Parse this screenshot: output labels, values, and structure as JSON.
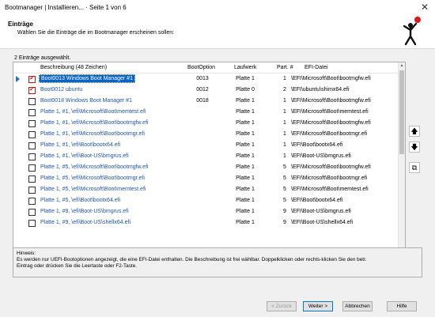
{
  "window": {
    "title": "Bootmanager | Installieren...   ·   Seite 1 von 6",
    "close_glyph": "✕"
  },
  "header": {
    "title": "Einträge",
    "subtitle": "Wählen Sie die Einträge die im Bootmanager erscheinen sollen:"
  },
  "selection_count": "2 Einträge ausgewählt.",
  "columns": {
    "description": "Beschreibung (48 Zeichen)",
    "bootoption": "BootOption",
    "drive": "Laufwerk",
    "part": "Part. #",
    "efi": "EFI-Datei"
  },
  "rows": [
    {
      "checked": true,
      "current": true,
      "selected": true,
      "description": "Boot0013 Windows Boot Manager #1",
      "bootoption": "0013",
      "drive": "Platte 1",
      "part": "1",
      "efi": "\\EFI\\Microsoft\\Boot\\bootmgfw.efi"
    },
    {
      "checked": true,
      "current": false,
      "selected": false,
      "description": "Boot0012 ubuntu",
      "bootoption": "0012",
      "drive": "Platte 0",
      "part": "2",
      "efi": "\\EFI\\ubuntu\\shimx64.efi"
    },
    {
      "checked": false,
      "current": false,
      "selected": false,
      "description": "Boot0018 Windows Boot Manager #1",
      "bootoption": "0018",
      "drive": "Platte 1",
      "part": "1",
      "efi": "\\EFI\\Microsoft\\Boot\\bootmgfw.efi"
    },
    {
      "checked": false,
      "current": false,
      "selected": false,
      "description": "Platte 1, #1, \\efi\\Microsoft\\Boot\\memtest.efi",
      "bootoption": "",
      "drive": "Platte 1",
      "part": "1",
      "efi": "\\EFI\\Microsoft\\Boot\\memtest.efi"
    },
    {
      "checked": false,
      "current": false,
      "selected": false,
      "description": "Platte 1, #1, \\efi\\Microsoft\\Boot\\bootmgfw.efi",
      "bootoption": "",
      "drive": "Platte 1",
      "part": "1",
      "efi": "\\EFI\\Microsoft\\Boot\\bootmgfw.efi"
    },
    {
      "checked": false,
      "current": false,
      "selected": false,
      "description": "Platte 1, #1, \\efi\\Microsoft\\Boot\\bootmgr.efi",
      "bootoption": "",
      "drive": "Platte 1",
      "part": "1",
      "efi": "\\EFI\\Microsoft\\Boot\\bootmgr.efi"
    },
    {
      "checked": false,
      "current": false,
      "selected": false,
      "description": "Platte 1, #1, \\efi\\Boot\\bootx64.efi",
      "bootoption": "",
      "drive": "Platte 1",
      "part": "1",
      "efi": "\\EFI\\Boot\\bootx64.efi"
    },
    {
      "checked": false,
      "current": false,
      "selected": false,
      "description": "Platte 1, #1, \\efi\\Boot-US\\bmgrus.efi",
      "bootoption": "",
      "drive": "Platte 1",
      "part": "1",
      "efi": "\\EFI\\Boot-US\\bmgrus.efi"
    },
    {
      "checked": false,
      "current": false,
      "selected": false,
      "description": "Platte 1, #5, \\efi\\Microsoft\\Boot\\bootmgfw.efi",
      "bootoption": "",
      "drive": "Platte 1",
      "part": "5",
      "efi": "\\EFI\\Microsoft\\Boot\\bootmgfw.efi"
    },
    {
      "checked": false,
      "current": false,
      "selected": false,
      "description": "Platte 1, #5, \\efi\\Microsoft\\Boot\\bootmgr.efi",
      "bootoption": "",
      "drive": "Platte 1",
      "part": "5",
      "efi": "\\EFI\\Microsoft\\Boot\\bootmgr.efi"
    },
    {
      "checked": false,
      "current": false,
      "selected": false,
      "description": "Platte 1, #5, \\efi\\Microsoft\\Boot\\memtest.efi",
      "bootoption": "",
      "drive": "Platte 1",
      "part": "5",
      "efi": "\\EFI\\Microsoft\\Boot\\memtest.efi"
    },
    {
      "checked": false,
      "current": false,
      "selected": false,
      "description": "Platte 1, #5, \\efi\\Boot\\bootx64.efi",
      "bootoption": "",
      "drive": "Platte 1",
      "part": "5",
      "efi": "\\EFI\\Boot\\bootx64.efi"
    },
    {
      "checked": false,
      "current": false,
      "selected": false,
      "description": "Platte 1, #9, \\efi\\Boot-US\\bmgrus.efi",
      "bootoption": "",
      "drive": "Platte 1",
      "part": "9",
      "efi": "\\EFI\\Boot-US\\bmgrus.efi"
    },
    {
      "checked": false,
      "current": false,
      "selected": false,
      "description": "Platte 1, #9, \\efi\\Boot-US\\shellx64.efi",
      "bootoption": "",
      "drive": "Platte 1",
      "part": "9",
      "efi": "\\EFI\\Boot-US\\shellx64.efi"
    }
  ],
  "side_buttons": {
    "up": "🡅",
    "down": "🡇",
    "copy": "⧉"
  },
  "hint": {
    "label": "Hinweis:",
    "line1": "Es werden nur UEFI-Bootoptionen angezeigt, die eine EFI-Datei enthalten. Die Beschreibung ist frei wählbar. Doppelklicken oder rechts-klicken Sie den betr.",
    "line2": "Eintrag oder drücken Sie die Leertaste oder F2-Taste."
  },
  "buttons": {
    "back": "< Zurück",
    "next": "Weiter >",
    "cancel": "Abbrechen",
    "help": "Hilfe"
  },
  "colors": {
    "accent": "#0a64c8",
    "link": "#1f55b0",
    "check": "#b01c1c"
  }
}
